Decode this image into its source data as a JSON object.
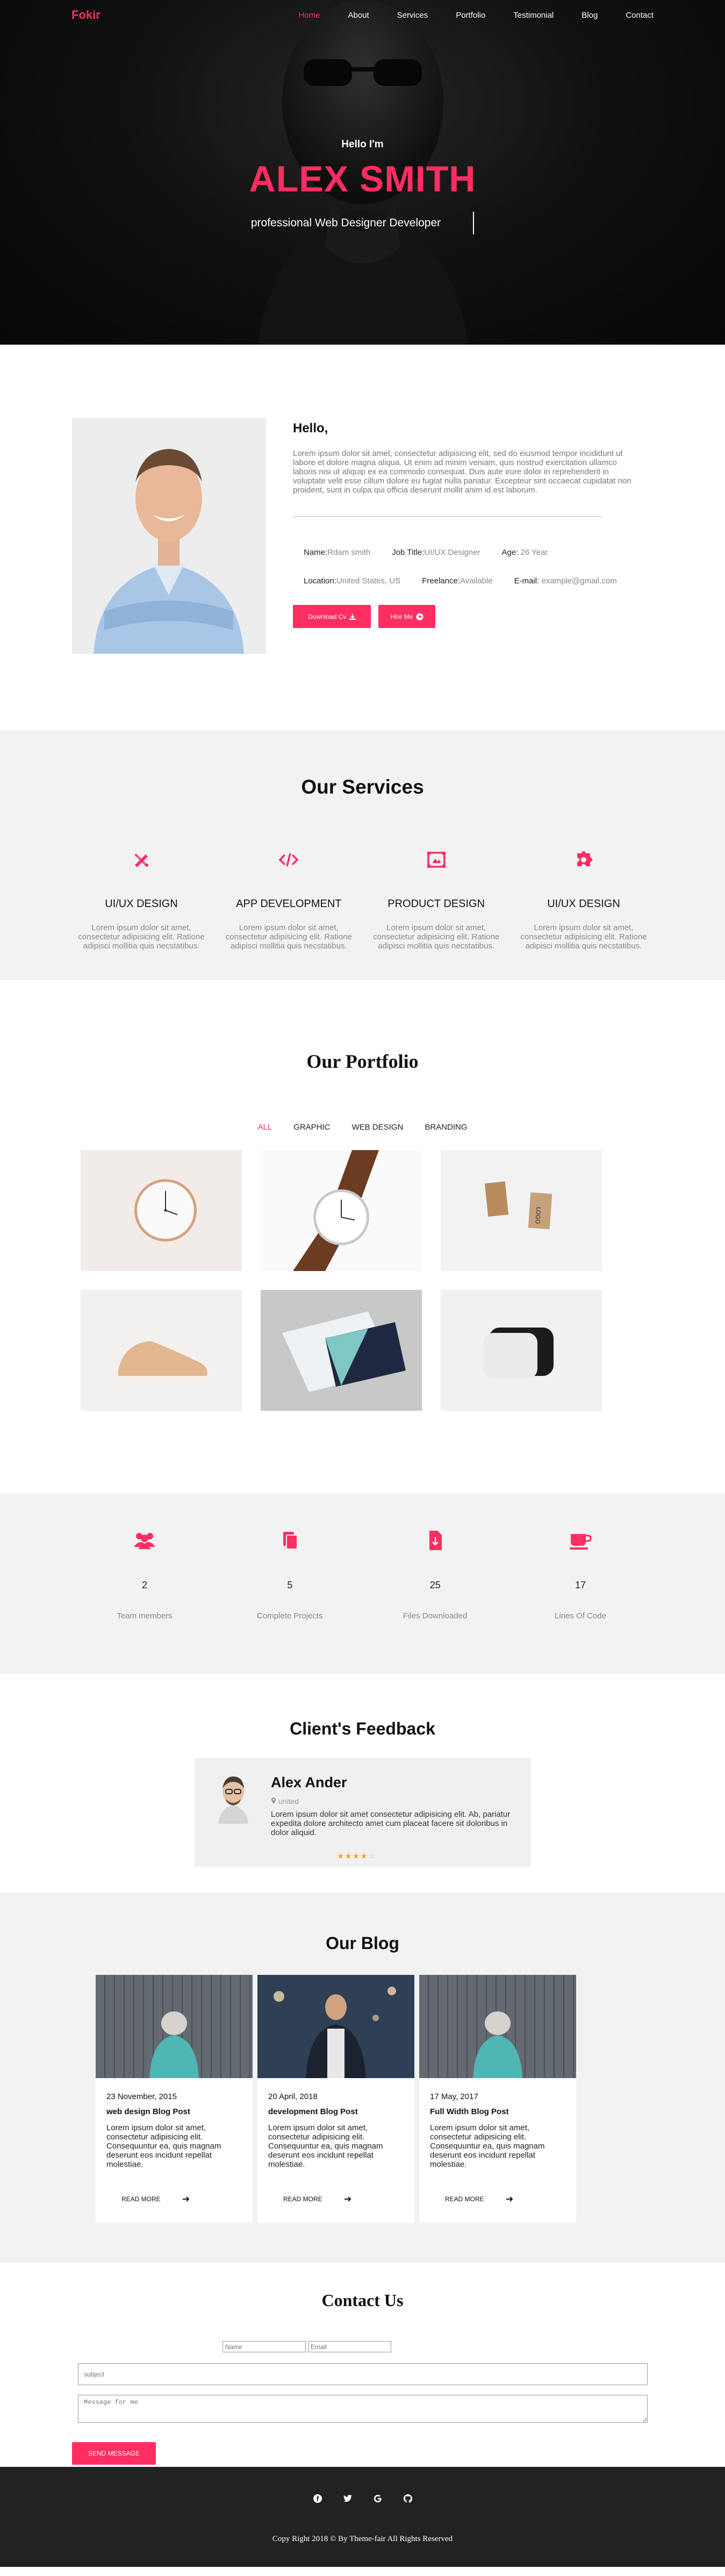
{
  "brand": {
    "logo": "Fokir",
    "accent": "#ff2d62"
  },
  "nav": {
    "items": [
      {
        "label": "Home",
        "active": true
      },
      {
        "label": "About"
      },
      {
        "label": "Services"
      },
      {
        "label": "Portfolio"
      },
      {
        "label": "Testimonial"
      },
      {
        "label": "Blog"
      },
      {
        "label": "Contact"
      }
    ]
  },
  "hero": {
    "greeting": "Hello I'm",
    "name": "ALEX SMITH",
    "role": "professional Web Designer Developer"
  },
  "about": {
    "heading": "Hello,",
    "description": "Lorem ipsum dolor sit amet, consectetur adipisicing elit, sed do eiusmod tempor incididunt ut labore et dolore magna aliqua. Ut enim ad minim veniam, quis nostrud exercitation ullamco laboris nisi ut aliquip ex ea commodo consequat. Duis aute irure dolor in reprehenderit in voluptate velit esse cillum dolore eu fugiat nulla pariatur. Excepteur sint occaecat cupidatat non proident, sunt in culpa qui officia deserunt mollit anim id est laborum.",
    "name_label": "Name:",
    "name_value": "Rdam smith",
    "job_label": "Job Title:",
    "job_value": "UI/UX Designer",
    "age_label": "Age:",
    "age_value": "26 Year",
    "location_label": "Location:",
    "location_value": "United States, US",
    "freelance_label": "Freelance:",
    "freelance_value": "Available",
    "email_label": "E-mail:",
    "email_value": "example@gmail.com",
    "download_label": "Download Cv",
    "hire_label": "Hire Me"
  },
  "services": {
    "title": "Our Services",
    "items": [
      {
        "title": "UI/UX DESIGN",
        "text": "Lorem ipsum dolor sit amet, consectetur adipisicing elit. Ratione adipisci mollitia quis necstatibus.",
        "icon": "design-tools-icon"
      },
      {
        "title": "APP DEVELOPMENT",
        "text": "Lorem ipsum dolor sit amet, consectetur adipisicing elit. Ratione adipisci mollitia quis necstatibus.",
        "icon": "code-icon"
      },
      {
        "title": "PRODUCT DESIGN",
        "text": "Lorem ipsum dolor sit amet, consectetur adipisicing elit. Ratione adipisci mollitia quis necstatibus.",
        "icon": "frame-icon"
      },
      {
        "title": "UI/UX DESIGN",
        "text": "Lorem ipsum dolor sit amet, consectetur adipisicing elit. Ratione adipisci mollitia quis necstatibus.",
        "icon": "puzzle-icon"
      }
    ]
  },
  "portfolio": {
    "title": "Our Portfolio",
    "filters": [
      {
        "label": "ALL",
        "active": true
      },
      {
        "label": "GRAPHIC"
      },
      {
        "label": "WEB DESIGN"
      },
      {
        "label": "BRANDING"
      }
    ],
    "items": [
      "wall-clock",
      "wrist-watch",
      "business-cards",
      "sneaker",
      "stationery",
      "speaker"
    ]
  },
  "stats": {
    "items": [
      {
        "value": "2",
        "label": "Team members",
        "icon": "team-icon"
      },
      {
        "value": "5",
        "label": "Complete Projects",
        "icon": "files-icon"
      },
      {
        "value": "25",
        "label": "Files Downloaded",
        "icon": "download-file-icon"
      },
      {
        "value": "17",
        "label": "Lines Of Code",
        "icon": "coffee-icon"
      }
    ]
  },
  "feedback": {
    "title": "Client's Feedback",
    "name": "Alex Ander",
    "location": "united",
    "text": "Lorem ipsum dolor sit amet consectetur adipisicing elit. Ab, pariatur expedita dolore architecto amet cum placeat facere sit doloribus in dolor aliquid.",
    "rating": 4,
    "rating_max": 5
  },
  "blog": {
    "title": "Our Blog",
    "read_more": "READ MORE",
    "posts": [
      {
        "date": "23 November, 2015",
        "title": "web design Blog Post",
        "text": "Lorem ipsum dolor sit amet, consectetur adipisicing elit. Consequuntur ea, quis magnam deserunt eos incidunt repellat molestiae."
      },
      {
        "date": "20 April, 2018",
        "title": "development Blog Post",
        "text": "Lorem ipsum dolor sit amet, consectetur adipisicing elit. Consequuntur ea, quis magnam deserunt eos incidunt repellat molestiae."
      },
      {
        "date": "17 May, 2017",
        "title": "Full Width Blog Post",
        "text": "Lorem ipsum dolor sit amet, consectetur adipisicing elit. Consequuntur ea, quis magnam deserunt eos incidunt repellat molestiae."
      }
    ]
  },
  "contact": {
    "title": "Contact Us",
    "name_placeholder": "Name",
    "email_placeholder": "Email",
    "subject_placeholder": "subject",
    "message_placeholder": "Message for me",
    "send_label": "SEND MESSAGE"
  },
  "footer": {
    "socials": [
      "facebook-icon",
      "twitter-icon",
      "google-icon",
      "github-icon"
    ],
    "copyright": "Copy Right 2018 © By Theme-fair All Rights Reserved"
  }
}
